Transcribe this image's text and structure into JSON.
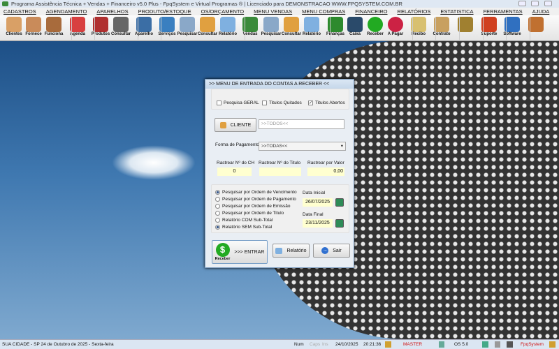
{
  "window": {
    "title": "Programa Assistência Técnica + Vendas + Financeiro v5.0 Plus - FpqSystem e Virtual Programas ® | Licenciado para  DEMONSTRACAO WWW.FPQSYSTEM.COM.BR"
  },
  "menu": [
    "CADASTROS",
    "AGENDAMENTO",
    "APARELHOS",
    "PRODUTO/ESTOQUE",
    "OS/ORÇAMENTO",
    "MENU VENDAS",
    "MENU COMPRAS",
    "FINANCEIRO",
    "RELATÓRIOS",
    "ESTATISTICA",
    "FERRAMENTAS",
    "AJUDA"
  ],
  "toolbar": [
    {
      "label": "Clientes",
      "icon": "clients-icon",
      "color": "#d9a066"
    },
    {
      "label": "Fornece",
      "icon": "supplier-icon",
      "color": "#c98b5a"
    },
    {
      "label": "Funciona",
      "icon": "employee-icon",
      "color": "#a86b3c"
    },
    {
      "label": "Agenda",
      "icon": "calendar-icon",
      "color": "#d84040"
    },
    {
      "label": "Produtos",
      "icon": "products-icon",
      "color": "#b03030"
    },
    {
      "label": "Consultar",
      "icon": "barcode-icon",
      "color": "#666666"
    },
    {
      "label": "Aparelho",
      "icon": "device-icon",
      "color": "#3b6ea5"
    },
    {
      "label": "Serviços",
      "icon": "services-icon",
      "color": "#3a7fc0"
    },
    {
      "label": "Pesquisar",
      "icon": "search-doc-icon",
      "color": "#8aa8c8"
    },
    {
      "label": "Consultar",
      "icon": "folder-icon",
      "color": "#e0a040"
    },
    {
      "label": "Relatório",
      "icon": "printer-icon",
      "color": "#7fb0e0"
    },
    {
      "label": "Vendas",
      "icon": "cart-icon",
      "color": "#3a8a3a"
    },
    {
      "label": "Pesquisar",
      "icon": "search-doc-icon",
      "color": "#8aa8c8"
    },
    {
      "label": "Consultar",
      "icon": "folder-icon",
      "color": "#e0a040"
    },
    {
      "label": "Relatório",
      "icon": "printer-icon",
      "color": "#7fb0e0"
    },
    {
      "label": "Finanças",
      "icon": "finance-icon",
      "color": "#2d8a2d"
    },
    {
      "label": "Caixa",
      "icon": "cashbook-icon",
      "color": "#2a4a6a"
    },
    {
      "label": "Receber",
      "icon": "dollar-green-icon",
      "color": "#22aa22"
    },
    {
      "label": "A Pagar",
      "icon": "dollar-red-icon",
      "color": "#cc2244"
    },
    {
      "label": "Recibo",
      "icon": "receipt-icon",
      "color": "#d8c070"
    },
    {
      "label": "Contrato",
      "icon": "contract-icon",
      "color": "#c8a060"
    },
    {
      "label": "",
      "icon": "coins-icon",
      "color": "#a08030"
    },
    {
      "label": "Suporte",
      "icon": "support-icon",
      "color": "#d04020"
    },
    {
      "label": "Software",
      "icon": "software-icon",
      "color": "#3070c0"
    },
    {
      "label": "",
      "icon": "exit-icon",
      "color": "#c07030"
    }
  ],
  "dialog": {
    "title": ">>  MENU DE ENTRADA DO CONTAS A RECEBER  <<",
    "checks": [
      {
        "label": "Pesquisa GERAL",
        "checked": false
      },
      {
        "label": "Titulos Quitados",
        "checked": false
      },
      {
        "label": "Titulos Abertos",
        "checked": true
      }
    ],
    "cliente_button": "CLIENTE",
    "cliente_value": ">>TODOS<<",
    "forma_label": "Forma de Pagamento",
    "forma_value": ">>TODAS<<",
    "rastrear": [
      {
        "label": "Rastrear Nº do CH",
        "value": "0"
      },
      {
        "label": "Rastrear Nº do Titulo",
        "value": ""
      },
      {
        "label": "Rastrear por Valor",
        "value": "0,00"
      }
    ],
    "radios": [
      {
        "label": "Pesquisar por Ordem de Vencimento",
        "checked": true
      },
      {
        "label": "Pesquisar por Ordem de Pagamento",
        "checked": false
      },
      {
        "label": "Pesquisar por Ordem de Emissão",
        "checked": false
      },
      {
        "label": "Pesquisar por Ordem de Titulo",
        "checked": false
      },
      {
        "label": "Relatório COM Sub-Total",
        "checked": false
      },
      {
        "label": "Relatório SEM Sub-Total",
        "checked": true
      }
    ],
    "data_inicial_label": "Data Inicial",
    "data_inicial": "26/07/2025",
    "data_final_label": "Data Final",
    "data_final": "23/11/2025",
    "entrar_label": ">>> ENTRAR",
    "entrar_icon_label": "Receber",
    "relatorio_label": "Relatório",
    "sair_label": "Sair"
  },
  "status": {
    "city": "SUA CIDADE - SP 24 de Outubro de 2025 - Sexta-feira",
    "num": "Num",
    "caps": "Caps",
    "ins": "Ins",
    "date": "24/10/2025",
    "time": "20:21:36",
    "user": "MASTER",
    "os": "OS 5.0",
    "brand": "FpqSystem"
  }
}
